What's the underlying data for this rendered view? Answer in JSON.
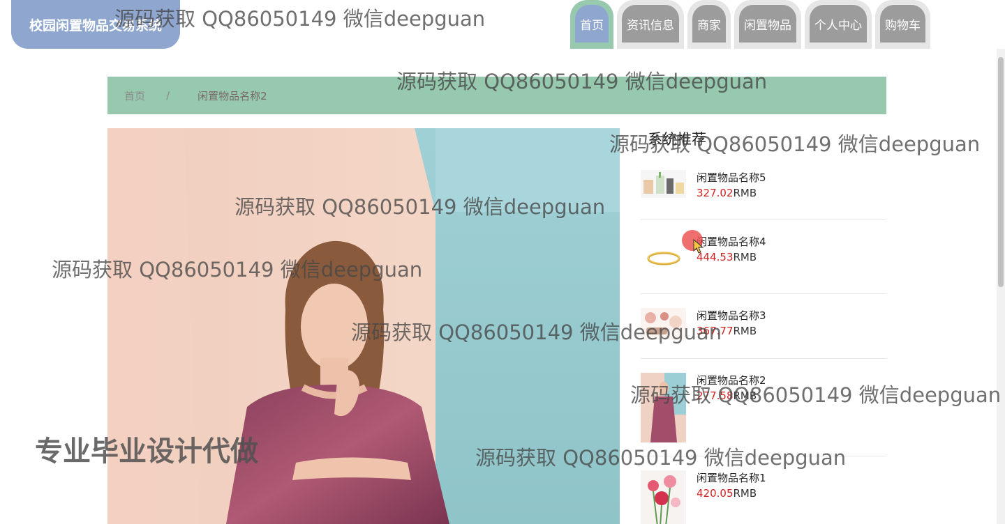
{
  "header": {
    "logo_text": "校园闲置物品交易系统",
    "nav": [
      {
        "label": "首页",
        "active": true
      },
      {
        "label": "资讯信息",
        "active": false
      },
      {
        "label": "商家",
        "active": false
      },
      {
        "label": "闲置物品",
        "active": false
      },
      {
        "label": "个人中心",
        "active": false
      },
      {
        "label": "购物车",
        "active": false
      }
    ]
  },
  "breadcrumb": {
    "home": "首页",
    "separator": "/",
    "current": "闲置物品名称2"
  },
  "main_image": {
    "description_icon": "product-photo-dress"
  },
  "recommend": {
    "title": "系统推荐",
    "items": [
      {
        "name": "闲置物品名称5",
        "price": "327.02",
        "unit": "RMB",
        "icon": "stationery-thumb"
      },
      {
        "name": "闲置物品名称4",
        "price": "444.53",
        "unit": "RMB",
        "icon": "ring-thumb"
      },
      {
        "name": "闲置物品名称3",
        "price": "367.77",
        "unit": "RMB",
        "icon": "cosmetics-thumb"
      },
      {
        "name": "闲置物品名称2",
        "price": "277.58",
        "unit": "RMB",
        "icon": "dress-thumb"
      },
      {
        "name": "闲置物品名称1",
        "price": "420.05",
        "unit": "RMB",
        "icon": "flowers-thumb"
      }
    ]
  },
  "watermarks": {
    "text": "源码获取 QQ86050149 微信deepguan",
    "promo": "专业毕业设计代做"
  },
  "colors": {
    "accent_blue": "#8fa6cf",
    "accent_green": "#96c9ae",
    "price_red": "#d02020"
  }
}
